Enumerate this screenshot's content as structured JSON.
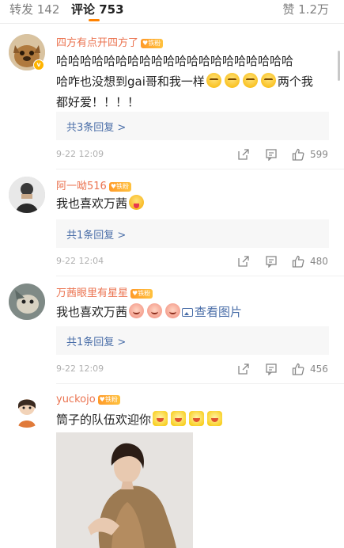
{
  "tabs": {
    "repost": "转发 142",
    "comments": "评论 753",
    "likes": "赞 1.2万"
  },
  "colors": {
    "accent": "#ff8200",
    "username": "#eb7350",
    "link": "#4a6ea8",
    "badge": "#ffb400"
  },
  "fan_badge_label": "铁粉",
  "comments": [
    {
      "username": "四方有点开四方了",
      "text_line1": "哈哈哈哈哈哈哈哈哈哈哈哈哈哈哈哈哈哈哈哈",
      "text_line2": "哈咋也没想到gai哥和我一样",
      "text_line2_end": "两个我",
      "text_line3": "都好爱！！！！",
      "replies": "共3条回复 >",
      "time": "9-22 12:09",
      "likes": "599"
    },
    {
      "username": "阿一呦516",
      "text": "我也喜欢万茜",
      "replies": "共1条回复 >",
      "time": "9-22 12:04",
      "likes": "480"
    },
    {
      "username": "万茜眼里有星星",
      "text": "我也喜欢万茜",
      "view_pic": "查看图片",
      "replies": "共1条回复 >",
      "time": "9-22 12:09",
      "likes": "456"
    },
    {
      "username": "yuckojo",
      "text": "筒子的队伍欢迎你"
    }
  ]
}
